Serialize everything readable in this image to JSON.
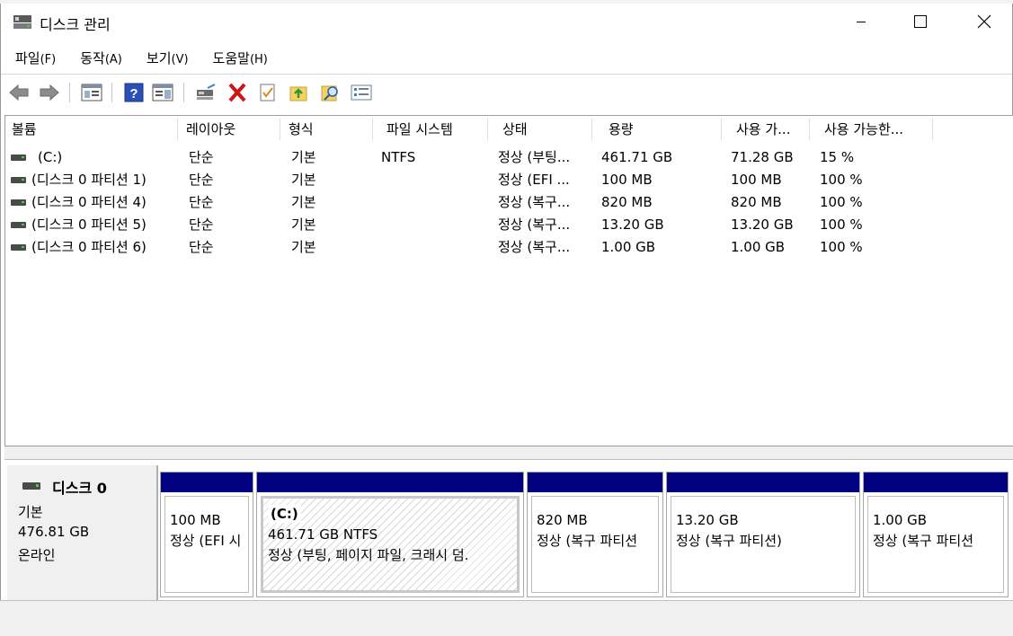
{
  "window": {
    "title": "디스크 관리"
  },
  "menu": [
    {
      "label": "파일",
      "key": "(F)"
    },
    {
      "label": "동작",
      "key": "(A)"
    },
    {
      "label": "보기",
      "key": "(V)"
    },
    {
      "label": "도움말",
      "key": "(H)"
    }
  ],
  "toolbar": [
    "back-icon",
    "forward-icon",
    "show-hide-console-tree-icon",
    "help-icon",
    "show-hide-action-pane-icon",
    "connect-drive-icon",
    "delete-icon",
    "properties-icon",
    "export-icon",
    "find-icon",
    "checklist-icon"
  ],
  "columns": [
    "볼륨",
    "레이아웃",
    "형식",
    "파일 시스템",
    "상태",
    "용량",
    "사용 가...",
    "사용 가능한..."
  ],
  "volumes": [
    {
      "name": "(C:)",
      "layout": "단순",
      "type": "기본",
      "fs": "NTFS",
      "status": "정상 (부팅...",
      "capacity": "461.71 GB",
      "free": "71.28 GB",
      "pct": "15 %"
    },
    {
      "name": "(디스크 0 파티션 1)",
      "layout": "단순",
      "type": "기본",
      "fs": "",
      "status": "정상 (EFI ...",
      "capacity": "100 MB",
      "free": "100 MB",
      "pct": "100 %"
    },
    {
      "name": "(디스크 0 파티션 4)",
      "layout": "단순",
      "type": "기본",
      "fs": "",
      "status": "정상 (복구...",
      "capacity": "820 MB",
      "free": "820 MB",
      "pct": "100 %"
    },
    {
      "name": "(디스크 0 파티션 5)",
      "layout": "단순",
      "type": "기본",
      "fs": "",
      "status": "정상 (복구...",
      "capacity": "13.20 GB",
      "free": "13.20 GB",
      "pct": "100 %"
    },
    {
      "name": "(디스크 0 파티션 6)",
      "layout": "단순",
      "type": "기본",
      "fs": "",
      "status": "정상 (복구...",
      "capacity": "1.00 GB",
      "free": "1.00 GB",
      "pct": "100 %"
    }
  ],
  "disk": {
    "name": "디스크 0",
    "kind": "기본",
    "size": "476.81 GB",
    "state": "온라인"
  },
  "partitions": [
    {
      "label": "",
      "size": "100 MB",
      "status": "정상 (EFI 시"
    },
    {
      "label": "(C:)",
      "size": "461.71 GB NTFS",
      "status": "정상 (부팅, 페이지 파일, 크래시 덤."
    },
    {
      "label": "",
      "size": "820 MB",
      "status": "정상 (복구 파티션"
    },
    {
      "label": "",
      "size": "13.20 GB",
      "status": "정상 (복구 파티션)"
    },
    {
      "label": "",
      "size": "1.00 GB",
      "status": "정상 (복구 파티션"
    }
  ],
  "colors": {
    "partition_header": "#000080",
    "hatch": "#d8d8d8"
  }
}
